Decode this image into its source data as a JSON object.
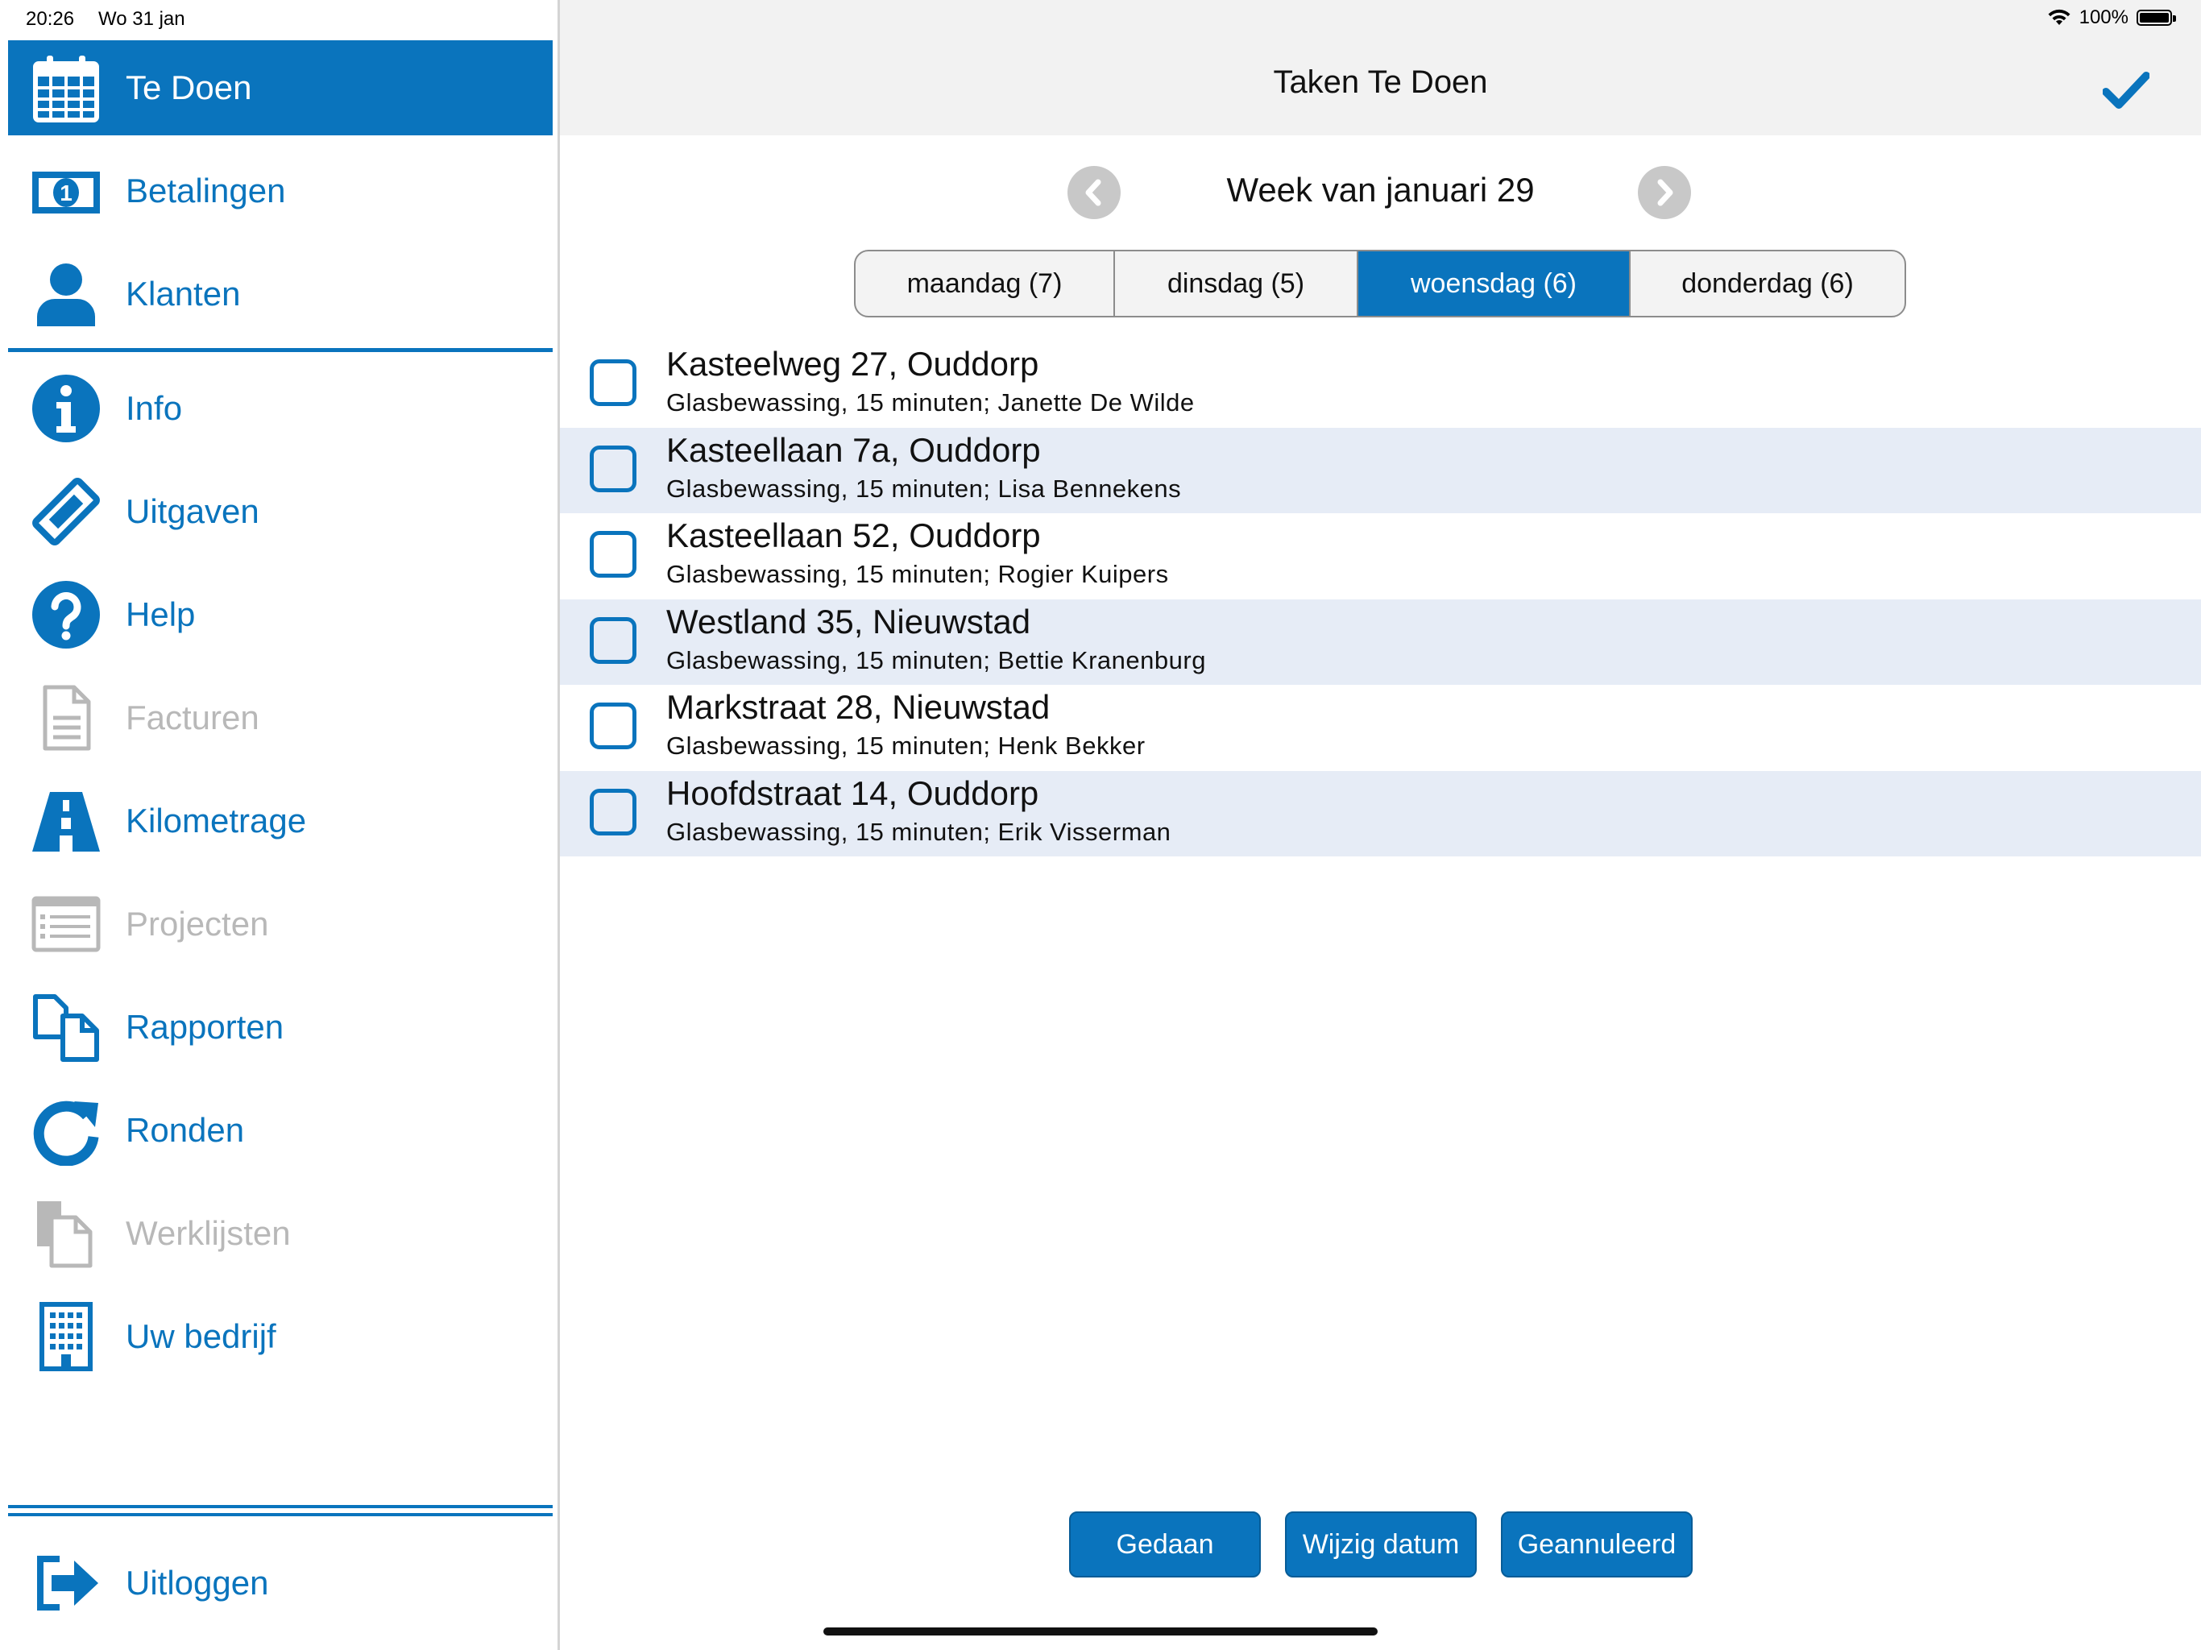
{
  "status_bar": {
    "time": "20:26",
    "date": "Wo 31 jan",
    "battery": "100%",
    "battery_level": 1.0
  },
  "colors": {
    "accent": "#0a74bd",
    "disabled": "#b8b8b8",
    "row_alt": "#e6ecf6"
  },
  "sidebar": {
    "top_items": [
      {
        "label": "Te Doen",
        "icon": "calendar-icon",
        "state": "active"
      },
      {
        "label": "Betalingen",
        "icon": "banknote-icon",
        "state": "enabled"
      },
      {
        "label": "Klanten",
        "icon": "person-icon",
        "state": "enabled"
      }
    ],
    "items": [
      {
        "label": "Info",
        "icon": "info-icon",
        "state": "enabled"
      },
      {
        "label": "Uitgaven",
        "icon": "ticket-icon",
        "state": "enabled"
      },
      {
        "label": "Help",
        "icon": "help-icon",
        "state": "enabled"
      },
      {
        "label": "Facturen",
        "icon": "document-icon",
        "state": "disabled"
      },
      {
        "label": "Kilometrage",
        "icon": "road-icon",
        "state": "enabled"
      },
      {
        "label": "Projecten",
        "icon": "list-icon",
        "state": "disabled"
      },
      {
        "label": "Rapporten",
        "icon": "copy-icon",
        "state": "enabled"
      },
      {
        "label": "Ronden",
        "icon": "refresh-icon",
        "state": "enabled"
      },
      {
        "label": "Werklijsten",
        "icon": "clipboard-icon",
        "state": "disabled"
      },
      {
        "label": "Uw bedrijf",
        "icon": "building-icon",
        "state": "enabled"
      }
    ],
    "logout": {
      "label": "Uitloggen",
      "icon": "logout-icon"
    }
  },
  "header": {
    "title": "Taken Te Doen",
    "done_icon": "checkmark-icon"
  },
  "week": {
    "title": "Week van januari 29",
    "prev_icon": "chevron-left-icon",
    "next_icon": "chevron-right-icon"
  },
  "days": [
    {
      "label": "maandag (7)",
      "active": false
    },
    {
      "label": "dinsdag (5)",
      "active": false
    },
    {
      "label": "woensdag (6)",
      "active": true
    },
    {
      "label": "donderdag (6)",
      "active": false
    }
  ],
  "tasks": [
    {
      "address": "Kasteelweg 27, Ouddorp",
      "details": "Glasbewassing, 15 minuten; Janette De Wilde",
      "checked": false
    },
    {
      "address": "Kasteellaan 7a, Ouddorp",
      "details": "Glasbewassing, 15 minuten; Lisa Bennekens",
      "checked": false
    },
    {
      "address": "Kasteellaan 52, Ouddorp",
      "details": "Glasbewassing, 15 minuten; Rogier Kuipers",
      "checked": false
    },
    {
      "address": "Westland 35, Nieuwstad",
      "details": "Glasbewassing, 15 minuten; Bettie Kranenburg",
      "checked": false
    },
    {
      "address": "Markstraat 28, Nieuwstad",
      "details": "Glasbewassing, 15 minuten; Henk Bekker",
      "checked": false
    },
    {
      "address": "Hoofdstraat 14, Ouddorp",
      "details": "Glasbewassing, 15 minuten; Erik Visserman",
      "checked": false
    }
  ],
  "actions": {
    "done": "Gedaan",
    "change_date": "Wijzig datum",
    "cancelled": "Geannuleerd"
  }
}
